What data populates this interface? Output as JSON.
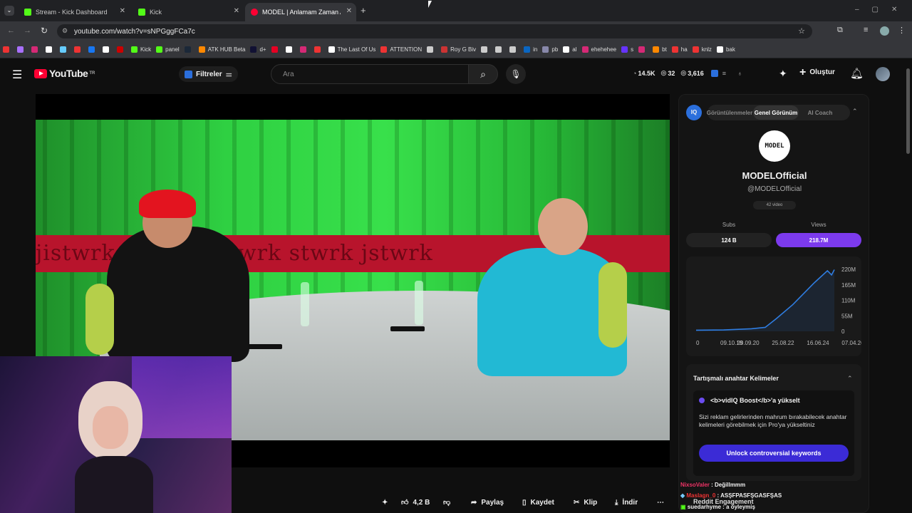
{
  "browser": {
    "tabs": [
      {
        "label": "Stream - Kick Dashboard",
        "color": "#53fc18"
      },
      {
        "label": "Kick",
        "color": "#53fc18"
      },
      {
        "label": "MODEL | Anlamam Zaman Aldı",
        "color": "#ff0033"
      }
    ],
    "new_tab": "+",
    "url": "youtube.com/watch?v=sNPGggFCa7c"
  },
  "bookmarks": [
    {
      "label": "",
      "color": "#e33"
    },
    {
      "label": "",
      "color": "#a970ff"
    },
    {
      "label": "",
      "color": "#d62976"
    },
    {
      "label": "",
      "color": "#fff"
    },
    {
      "label": "",
      "color": "#6cf"
    },
    {
      "label": "",
      "color": "#e33"
    },
    {
      "label": "",
      "color": "#1877f2"
    },
    {
      "label": "",
      "color": "#fff"
    },
    {
      "label": "",
      "color": "#c00"
    },
    {
      "label": "Kick",
      "color": "#53fc18"
    },
    {
      "label": "panel",
      "color": "#53fc18"
    },
    {
      "label": "",
      "color": "#1b2838"
    },
    {
      "label": "ATK HUB Beta",
      "color": "#f80"
    },
    {
      "label": "d+",
      "color": "#113"
    },
    {
      "label": "",
      "color": "#e60023"
    },
    {
      "label": "",
      "color": "#fff"
    },
    {
      "label": "",
      "color": "#d62976"
    },
    {
      "label": "",
      "color": "#e33"
    },
    {
      "label": "The Last Of Us",
      "color": "#fff"
    },
    {
      "label": "ATTENTION",
      "color": "#e33"
    },
    {
      "label": "",
      "color": "#ccc"
    },
    {
      "label": "Roy G Biv",
      "color": "#c33"
    },
    {
      "label": "",
      "color": "#ccc"
    },
    {
      "label": "",
      "color": "#ccc"
    },
    {
      "label": "",
      "color": "#ccc"
    },
    {
      "label": "in",
      "color": "#0a66c2"
    },
    {
      "label": "pb",
      "color": "#88a"
    },
    {
      "label": "al",
      "color": "#fff"
    },
    {
      "label": "ehehehee",
      "color": "#d62976"
    },
    {
      "label": "s",
      "color": "#63f"
    },
    {
      "label": "",
      "color": "#d62976"
    },
    {
      "label": "bt",
      "color": "#f80"
    },
    {
      "label": "ha",
      "color": "#e33"
    },
    {
      "label": "knlz",
      "color": "#e33"
    },
    {
      "label": "bak",
      "color": "#fff"
    }
  ],
  "youtube": {
    "logo": "YouTube",
    "region": "TR",
    "filters": "Filtreler",
    "search_placeholder": "Ara",
    "stats": [
      "14.5K",
      "32",
      "3,616"
    ],
    "create": "Oluştur"
  },
  "video": {
    "banner": "jistwrk  jstwrk    jistwrk  stwrk    jstwrk"
  },
  "panel": {
    "tabs": [
      "Görüntülenmeler",
      "Genel Görünüm",
      "AI Coach"
    ],
    "logo_text": "MODEL",
    "channel": "MODELOfficial",
    "handle": "@MODELOfficial",
    "video_count": "42 video",
    "subs_label": "Subs",
    "views_label": "Views",
    "subs": "124 B",
    "views": "218.7M",
    "keywords_title": "Tartışmalı anahtar Kelimeler",
    "boost_title": "<b>vidIQ Boost</b>'a yükselt",
    "boost_body": "Sizi reklam gelirlerinden mahrum bırakabilecek anahtar kelimeleri görebilmek için Pro'ya yükseltiniz",
    "unlock": "Unlock controversial keywords",
    "reddit": "Reddit Engagement",
    "accent": "#7c3aed"
  },
  "chart_data": {
    "type": "line",
    "x": [
      "09.10.18",
      "29.09.20",
      "25.08.22",
      "16.06.24",
      "07.04.26"
    ],
    "y_ticks": [
      "220M",
      "165M",
      "110M",
      "55M",
      "0"
    ],
    "series": [
      {
        "values": [
          [
            0,
            4
          ],
          [
            0.2,
            5
          ],
          [
            0.4,
            9
          ],
          [
            0.5,
            14
          ],
          [
            0.58,
            45
          ],
          [
            0.7,
            95
          ],
          [
            0.85,
            170
          ],
          [
            0.95,
            215
          ],
          [
            0.98,
            200
          ],
          [
            1,
            218.7
          ]
        ]
      }
    ],
    "ylim": [
      0,
      220
    ],
    "color": "#2f7de1"
  },
  "actions": {
    "like": "4,2 B",
    "share": "Paylaş",
    "save": "Kaydet",
    "clip": "Klip",
    "download": "İndir"
  },
  "chat": [
    {
      "user": "NixsoValer",
      "msg": " : Değillmmm",
      "color": "#e36"
    },
    {
      "user": "Maslagn_0",
      "msg": " : ASŞFPASFŞGASFŞAS",
      "color": "#e33"
    },
    {
      "user": "suedarhyme",
      "msg": " : a öyleymiş",
      "color": "#fff"
    }
  ]
}
